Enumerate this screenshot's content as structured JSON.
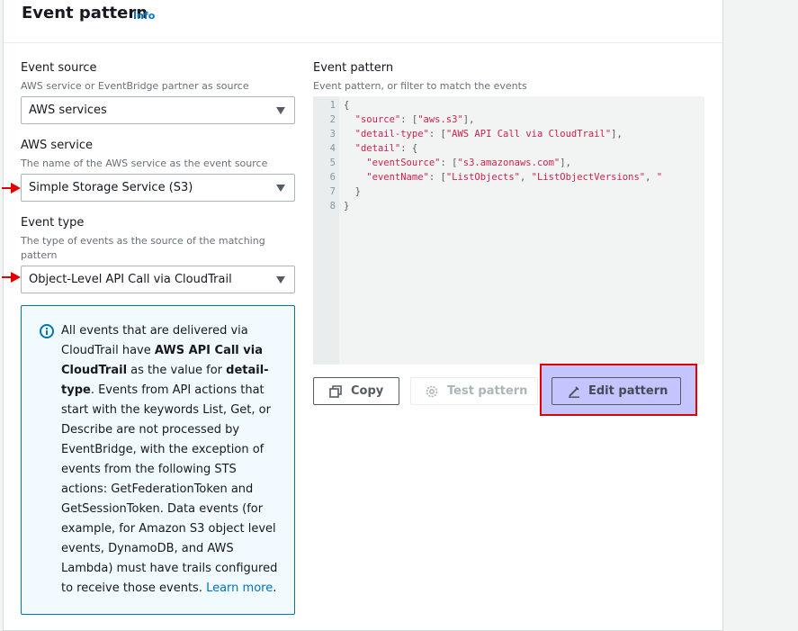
{
  "panel": {
    "title": "Event pattern",
    "info_link": "Info"
  },
  "event_source": {
    "label": "Event source",
    "description": "AWS service or EventBridge partner as source",
    "value": "AWS services"
  },
  "aws_service": {
    "label": "AWS service",
    "description": "The name of the AWS service as the event source",
    "value": "Simple Storage Service (S3)"
  },
  "event_type": {
    "label": "Event type",
    "description_line1": "The type of events as the source of the matching",
    "description_line2": "pattern",
    "value": "Object-Level API Call via CloudTrail"
  },
  "alert": {
    "l1": "All events that are delivered via",
    "l2a": "CloudTrail have ",
    "l2b": "AWS API Call via",
    "l3a": "CloudTrail",
    "l3b": " as the value for ",
    "l3c": "detail-",
    "l4a": "type",
    "l4b": ". Events from API actions that",
    "l5": "start with the keywords List, Get, or",
    "l6": "Describe are not processed by",
    "l7": "EventBridge, with the exception of",
    "l8": "events from the following STS",
    "l9": "actions: GetFederationToken and",
    "l10": "GetSessionToken. Data events (for",
    "l11": "example, for Amazon S3 object level",
    "l12": "events, DynamoDB, and AWS",
    "l13": "Lambda) must have trails configured",
    "l14a": "to receive those events. ",
    "l14b": "Learn more",
    "l14c": "."
  },
  "pattern": {
    "label": "Event pattern",
    "description": "Event pattern, or filter to match the events",
    "lines": [
      {
        "n": "1",
        "text": "{"
      },
      {
        "n": "2",
        "text": "  \"source\": [\"aws.s3\"],"
      },
      {
        "n": "3",
        "text": "  \"detail-type\": [\"AWS API Call via CloudTrail\"],"
      },
      {
        "n": "4",
        "text": "  \"detail\": {"
      },
      {
        "n": "5",
        "text": "    \"eventSource\": [\"s3.amazonaws.com\"],"
      },
      {
        "n": "6",
        "text": "    \"eventName\": [\"ListObjects\", \"ListObjectVersions\", \""
      },
      {
        "n": "7",
        "text": "  }"
      },
      {
        "n": "8",
        "text": "}"
      }
    ]
  },
  "buttons": {
    "copy": "Copy",
    "test": "Test pattern",
    "edit": "Edit pattern"
  },
  "colors": {
    "link": "#0073bb",
    "highlight_border": "#e00000",
    "highlight_fill": "#c4c4ff",
    "annotation_arrow": "#e00000"
  },
  "icons": [
    "info-icon",
    "copy-icon",
    "gear-icon",
    "pencil-icon",
    "caret-down-icon",
    "red-arrow-icon"
  ]
}
